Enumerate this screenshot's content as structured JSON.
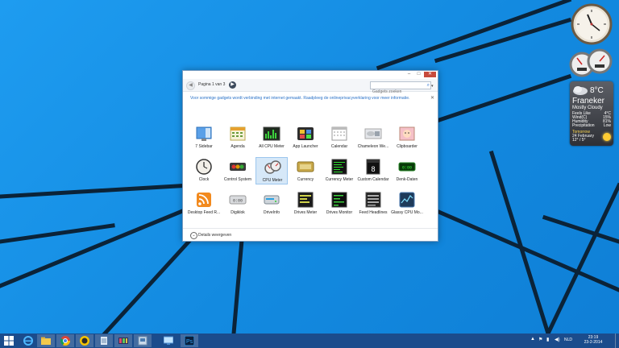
{
  "desktop": {
    "weather": {
      "city": "Franeker",
      "condition": "Mostly Cloudy",
      "temperature": "8°C",
      "rows": [
        {
          "label": "Feels Like",
          "value": "4°C"
        },
        {
          "label": "Wind(C)",
          "value": "15%"
        },
        {
          "label": "Humidity",
          "value": "81%"
        },
        {
          "label": "Precipitation",
          "value": "Low"
        }
      ],
      "forecast_title": "Tomorrow",
      "forecast_date": "24 February",
      "forecast_temps": "12° / 5°"
    }
  },
  "dialog": {
    "page_indicator": "Pagina 1 van 3",
    "search_placeholder": "Gadgets zoeken",
    "notice": "Voor sommige gadgets wordt verbinding met internet gemaakt. Raadpleeg de onlineprivacyverklaring voor meer informatie.",
    "details_label": "Details weergeven",
    "gadgets": [
      {
        "label": "7 Sidebar",
        "icon": "sidebar-icon"
      },
      {
        "label": "Agenda",
        "icon": "agenda-icon"
      },
      {
        "label": "All CPU Meter",
        "icon": "all-cpu-meter-icon"
      },
      {
        "label": "App Launcher",
        "icon": "app-launcher-icon"
      },
      {
        "label": "Calendar",
        "icon": "calendar-icon"
      },
      {
        "label": "Chameleon We...",
        "icon": "chameleon-weather-icon"
      },
      {
        "label": "Clipboarder",
        "icon": "clipboarder-icon"
      },
      {
        "label": "Clock",
        "icon": "clock-icon"
      },
      {
        "label": "Control System",
        "icon": "control-system-icon"
      },
      {
        "label": "CPU Meter",
        "icon": "cpu-meter-icon",
        "selected": true
      },
      {
        "label": "Currency",
        "icon": "currency-icon"
      },
      {
        "label": "Currency Meter",
        "icon": "currency-meter-icon"
      },
      {
        "label": "Custom Calendar",
        "icon": "custom-calendar-icon"
      },
      {
        "label": "Denk-Daten",
        "icon": "denk-daten-icon"
      },
      {
        "label": "Desktop Feed R...",
        "icon": "rss-feed-icon"
      },
      {
        "label": "Digiklok",
        "icon": "digiklok-icon"
      },
      {
        "label": "DriveInfo",
        "icon": "driveinfo-icon"
      },
      {
        "label": "Drives Meter",
        "icon": "drives-meter-icon"
      },
      {
        "label": "Drives Monitor",
        "icon": "drives-monitor-icon"
      },
      {
        "label": "Feed Headlines",
        "icon": "feed-headlines-icon"
      },
      {
        "label": "Glassy CPU Mo...",
        "icon": "glassy-cpu-monitor-icon"
      }
    ],
    "calendar_day": "8",
    "digital_time": "0:00"
  },
  "taskbar": {
    "language": "NLD",
    "time": "23:19",
    "date": "23-2-2014",
    "apps": [
      "start",
      "internet-explorer",
      "file-explorer",
      "chrome",
      "app-badge",
      "notepad",
      "media-app",
      "gadget-app",
      "remote-desktop",
      "photoshop"
    ],
    "accent_color": "#1b4c8c"
  }
}
